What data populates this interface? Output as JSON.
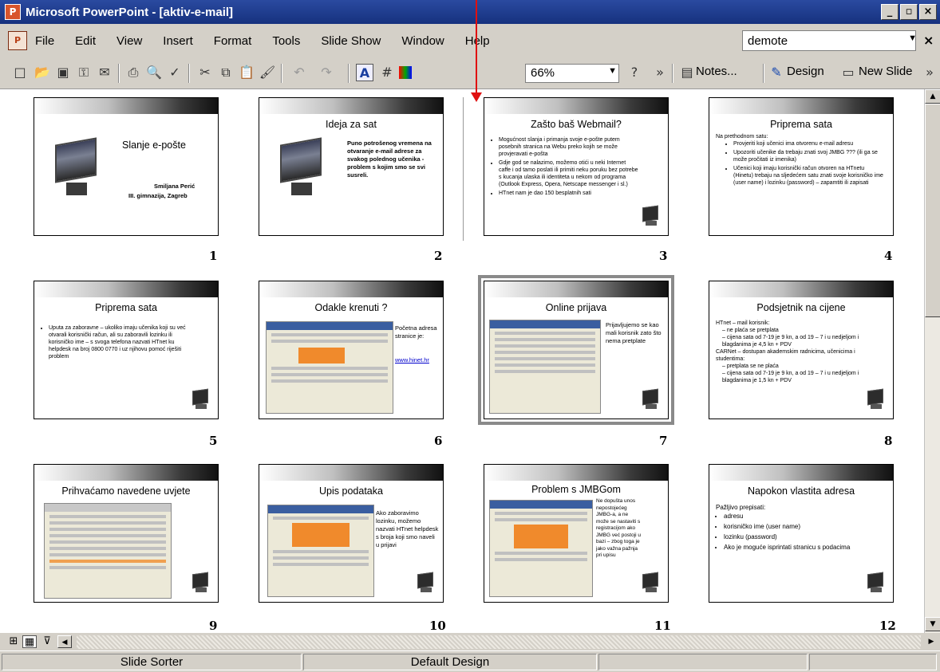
{
  "window": {
    "title": "Microsoft PowerPoint - [aktiv-e-mail]",
    "min": "_",
    "max": "▫",
    "close": "×"
  },
  "menu": {
    "items": [
      "File",
      "Edit",
      "View",
      "Insert",
      "Format",
      "Tools",
      "Slide Show",
      "Window",
      "Help"
    ],
    "help_query": "demote",
    "close": "×"
  },
  "toolbar": {
    "zoom": "66%",
    "notes_label": "Notes...",
    "design_label": "Design",
    "new_slide_label": "New Slide",
    "more": "»"
  },
  "slides": [
    {
      "num": "1",
      "title": "Slanje e-pošte",
      "author": "Smiljana Perić",
      "school": "III. gimnazija, Zagreb"
    },
    {
      "num": "2",
      "title": "Ideja za sat",
      "text": "Puno potrošenog vremena na otvaranje e-mail adrese za svakog polednog učenika - problem s kojim smo se svi susreli."
    },
    {
      "num": "3",
      "title": "Zašto baš Webmail?",
      "bullets": [
        "Mogućnost slanja i primanja svoje e-pošte putem posebnih stranica na Webu preko kojih se može provjeravati e-pošta",
        "Gdje god se nalazimo, možemo otići u neki Internet caffe i od tamo poslati ili primiti neku poruku bez potrebe s kucanja ulaska ili identiteta u nekom od programa (Outlook Express, Opera, Netscape messenger i sl.)",
        "HTnet nam je dao 150 besplatnih sati"
      ]
    },
    {
      "num": "4",
      "title": "Priprema sata",
      "intro": "Na prethodnom satu:",
      "bullets": [
        "Provjeriti koji učenici ima otvorenu e-mail adresu",
        "Upozoriti učenike da trebaju znati svoj JMBG ??? (ili ga se može pročitati iz imenika)",
        "Učenici koji imaju korisnički račun otvoren na HTnetu (Hinetu) trebaju na sljedećem satu znati svoje korisničko ime (user name) i lozinku (password) – zapamtiti ili zapisati"
      ]
    },
    {
      "num": "5",
      "title": "Priprema sata",
      "bullets": [
        "Uputa za zaboravne – ukoliko imaju učenika koji su već otvarali korisnički račun, ali su zaboravili lozinku ili korisničko ime – s svoga telefona nazvati HTnet ku helpdesk na broj 0800 0770 i uz njihovu pomoć riješiti problem"
      ]
    },
    {
      "num": "6",
      "title": "Odakle krenuti ?",
      "side": [
        "Početna adresa stranice je:",
        "www.hinet.hr"
      ]
    },
    {
      "num": "7",
      "title": "Online prijava",
      "side": [
        "Prijavljujemo se kao mali korisnik zato što nema pretplate"
      ]
    },
    {
      "num": "8",
      "title": "Podsjetnik na cijene",
      "bullets": [
        "HTnet – mail korisnik:",
        "– ne plaća se pretplata",
        "– cijena sata od 7-19 je 9 kn, a od 19 – 7 i u nedjeljom i blagdanima je 4,5 kn + PDV",
        "CARNet – dostupan akademskim radnicima, učenicima i studentima:",
        "– pretplata se ne plaća",
        "– cijena sata od 7-19 je 9 kn, a od 19 – 7 i u nedjeljom i blagdanima je 1,5 kn + PDV"
      ]
    },
    {
      "num": "9",
      "title": "Prihvaćamo navedene uvjete"
    },
    {
      "num": "10",
      "title": "Upis podataka",
      "side": [
        "Ako zaboravimo lozinku, možemo nazvati HTnet helpdesk s broja koji smo naveli u prijavi"
      ]
    },
    {
      "num": "11",
      "title": "Problem s JMBGom",
      "side": [
        "Ne dopušta unos nepostojećeg JMBG-a, a ne može se nastaviti s registracijom ako JMBG već postoji u bazi – zbog toga je jako važna pažnja pri upisu"
      ]
    },
    {
      "num": "12",
      "title": "Napokon vlastita adresa",
      "intro": "Pažljivo prepisati:",
      "bullets": [
        "adresu",
        "korisničko ime (user name)",
        "lozinku (password)",
        "Ako je moguće isprintati stranicu s podacima"
      ]
    }
  ],
  "status": {
    "view": "Slide Sorter",
    "design": "Default Design"
  }
}
